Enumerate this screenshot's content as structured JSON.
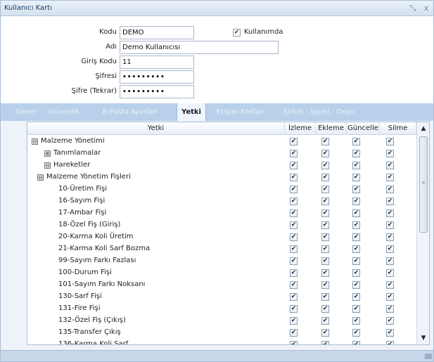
{
  "window": {
    "title": "Kullanıcı Kartı",
    "restore_glyph": "⤡",
    "close_glyph": "x"
  },
  "form": {
    "kodu_label": "Kodu",
    "kodu_value": "DEMO",
    "kullanimda_label": "Kullanımda",
    "kullanimda_checked": true,
    "adi_label": "Adı",
    "adi_value": "Demo Kullanıcısı",
    "giris_kodu_label": "Giriş Kodu",
    "giris_kodu_value": "11",
    "sifre_label": "Şifresi",
    "sifre_value": "•••••••••",
    "sifre_tekrar_label": "Şifre (Tekrar)",
    "sifre_tekrar_value": "•••••••••"
  },
  "tabs": [
    {
      "label": "Genel"
    },
    {
      "label": "Güvenlik"
    },
    {
      "label": "E-Posta Ayarları"
    },
    {
      "label": "Yetki"
    },
    {
      "label": "Erişim Kodları"
    },
    {
      "label": "Şirket - İşyeri - Depo"
    }
  ],
  "active_tab": "Yetki",
  "grid": {
    "columns": [
      "Yetki",
      "İzleme",
      "Ekleme",
      "Güncelle",
      "Silme"
    ],
    "rows": [
      {
        "label": "Malzeme Yönetimi",
        "expander": "⊟",
        "level": 0,
        "izleme": true,
        "ekleme": true,
        "guncelle": true,
        "silme": true
      },
      {
        "label": "Tanımlamalar",
        "expander": "⊞",
        "level": 1,
        "izleme": true,
        "ekleme": true,
        "guncelle": true,
        "silme": true
      },
      {
        "label": "Hareketler",
        "expander": "⊟",
        "level": 1,
        "izleme": true,
        "ekleme": true,
        "guncelle": true,
        "silme": true
      },
      {
        "label": "Malzeme Yönetim Fişleri",
        "expander": "⊟",
        "level": 2,
        "izleme": true,
        "ekleme": true,
        "guncelle": true,
        "silme": true
      },
      {
        "label": "10-Üretim Fişi",
        "expander": "",
        "level": 3,
        "izleme": true,
        "ekleme": true,
        "guncelle": true,
        "silme": true
      },
      {
        "label": "16-Sayım Fişi",
        "expander": "",
        "level": 3,
        "izleme": true,
        "ekleme": true,
        "guncelle": true,
        "silme": true
      },
      {
        "label": "17-Ambar Fişi",
        "expander": "",
        "level": 3,
        "izleme": true,
        "ekleme": true,
        "guncelle": true,
        "silme": true
      },
      {
        "label": "18-Özel Fiş (Giriş)",
        "expander": "",
        "level": 3,
        "izleme": true,
        "ekleme": true,
        "guncelle": true,
        "silme": true
      },
      {
        "label": "20-Karma Koli Üretim",
        "expander": "",
        "level": 3,
        "izleme": true,
        "ekleme": true,
        "guncelle": true,
        "silme": true
      },
      {
        "label": "21-Karma Koli Sarf Bozma",
        "expander": "",
        "level": 3,
        "izleme": true,
        "ekleme": true,
        "guncelle": true,
        "silme": true
      },
      {
        "label": "99-Sayım Farkı Fazlası",
        "expander": "",
        "level": 3,
        "izleme": true,
        "ekleme": true,
        "guncelle": true,
        "silme": true
      },
      {
        "label": "100-Durum Fişi",
        "expander": "",
        "level": 3,
        "izleme": true,
        "ekleme": true,
        "guncelle": true,
        "silme": true
      },
      {
        "label": "101-Sayım Farkı Noksanı",
        "expander": "",
        "level": 3,
        "izleme": true,
        "ekleme": true,
        "guncelle": true,
        "silme": true
      },
      {
        "label": "130-Sarf Fişi",
        "expander": "",
        "level": 3,
        "izleme": true,
        "ekleme": true,
        "guncelle": true,
        "silme": true
      },
      {
        "label": "131-Fire Fişi",
        "expander": "",
        "level": 3,
        "izleme": true,
        "ekleme": true,
        "guncelle": true,
        "silme": true
      },
      {
        "label": "132-Özel Fiş (Çıkış)",
        "expander": "",
        "level": 3,
        "izleme": true,
        "ekleme": true,
        "guncelle": true,
        "silme": true
      },
      {
        "label": "135-Transfer Çıkış",
        "expander": "",
        "level": 3,
        "izleme": true,
        "ekleme": true,
        "guncelle": true,
        "silme": true
      },
      {
        "label": "136-Karma Koli Sarf",
        "expander": "",
        "level": 3,
        "izleme": true,
        "ekleme": true,
        "guncelle": true,
        "silme": true
      }
    ]
  },
  "scrollbar": {
    "up_glyph": "▲",
    "down_glyph": "▼",
    "grip_glyph": "≡"
  },
  "check_glyph": "✔",
  "colors": {
    "tab_bar": "#b8d0ea",
    "title_bar": "#d4e1ef"
  }
}
